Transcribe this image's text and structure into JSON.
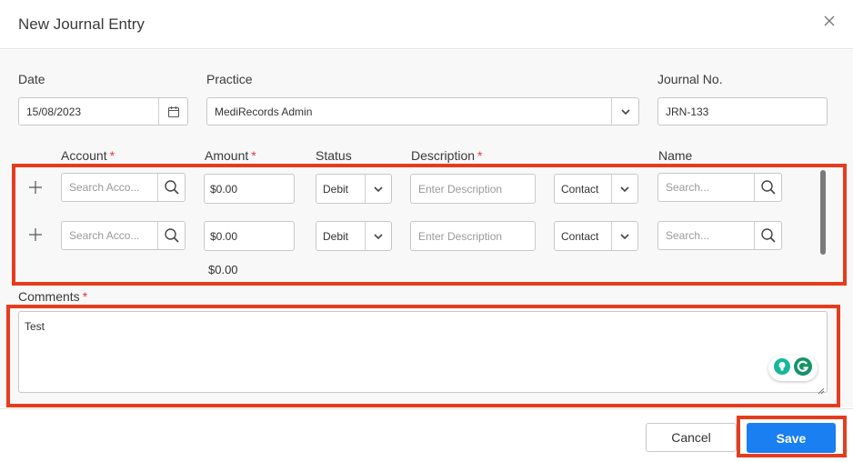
{
  "dialog": {
    "title": "New Journal Entry"
  },
  "fields": {
    "date_label": "Date",
    "date_value": "15/08/2023",
    "practice_label": "Practice",
    "practice_value": "MediRecords Admin",
    "journal_label": "Journal No.",
    "journal_value": "JRN-133"
  },
  "table": {
    "headers": {
      "account": "Account",
      "amount": "Amount",
      "status": "Status",
      "description": "Description",
      "name": "Name",
      "required_mark": "*"
    },
    "rows": [
      {
        "account_placeholder": "Search Acco...",
        "amount": "$0.00",
        "status": "Debit",
        "description_placeholder": "Enter Description",
        "type": "Contact",
        "name_placeholder": "Search..."
      },
      {
        "account_placeholder": "Search Acco...",
        "amount": "$0.00",
        "status": "Debit",
        "description_placeholder": "Enter Description",
        "type": "Contact",
        "name_placeholder": "Search..."
      }
    ],
    "total": "$0.00"
  },
  "comments": {
    "label": "Comments",
    "required_mark": "*",
    "value": "Test"
  },
  "footer": {
    "cancel_label": "Cancel",
    "save_label": "Save"
  },
  "colors": {
    "accent": "#1a7ff0",
    "highlight": "#e63c1e",
    "required": "#e0393c"
  }
}
